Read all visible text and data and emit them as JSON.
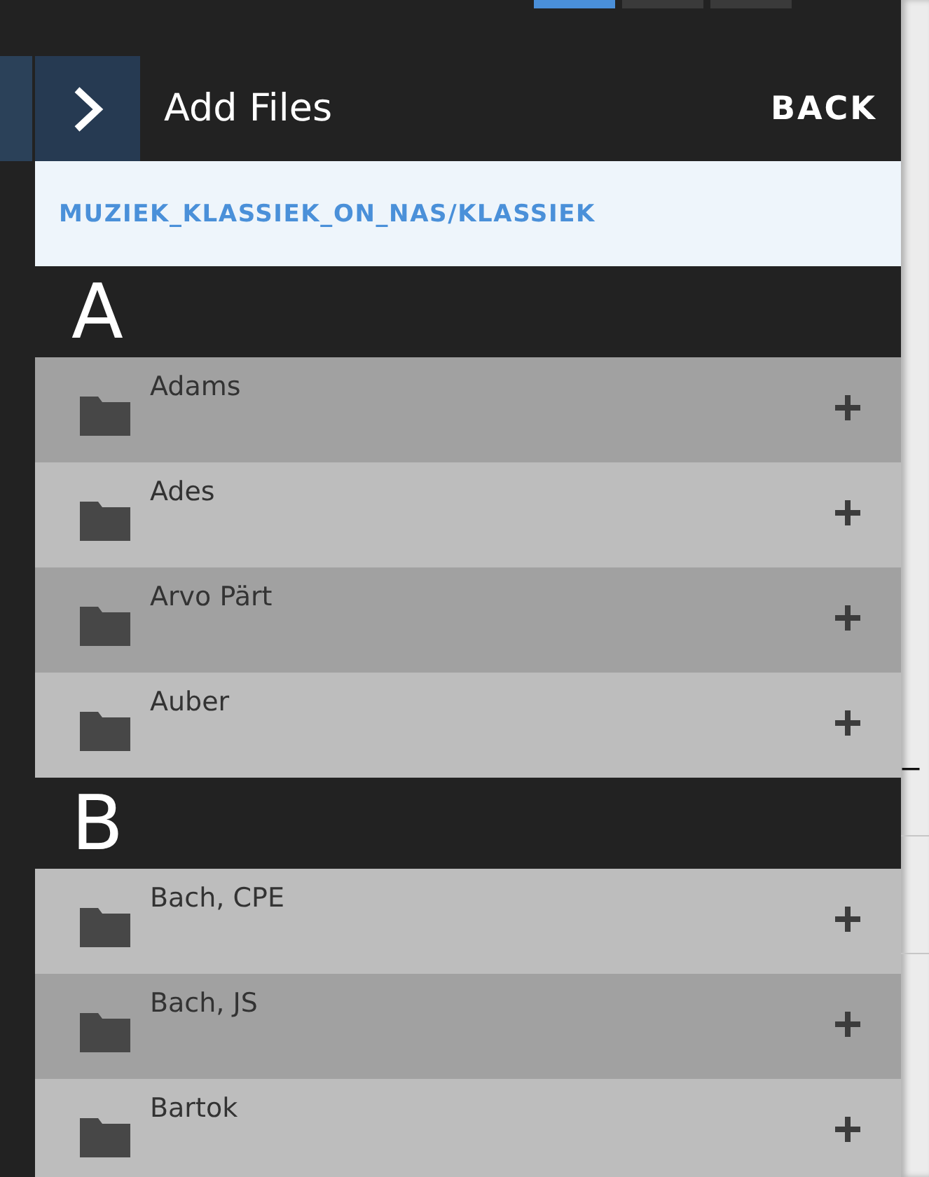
{
  "tabs": [
    {
      "selected": true
    },
    {
      "selected": false
    },
    {
      "selected": false
    }
  ],
  "header": {
    "title": "Add Files",
    "back": "BACK"
  },
  "path": "MUZIEK_KLASSIEK_ON_NAS/KLASSIEK",
  "sections": [
    {
      "letter": "A",
      "items": [
        {
          "name": "Adams",
          "shaded": true
        },
        {
          "name": "Ades",
          "shaded": false
        },
        {
          "name": "Arvo Pärt",
          "shaded": true
        },
        {
          "name": "Auber",
          "shaded": false
        }
      ]
    },
    {
      "letter": "B",
      "items": [
        {
          "name": "Bach, CPE",
          "shaded": false
        },
        {
          "name": "Bach, JS",
          "shaded": true
        },
        {
          "name": "Bartok",
          "shaded": false
        }
      ]
    }
  ],
  "background_text": "_"
}
